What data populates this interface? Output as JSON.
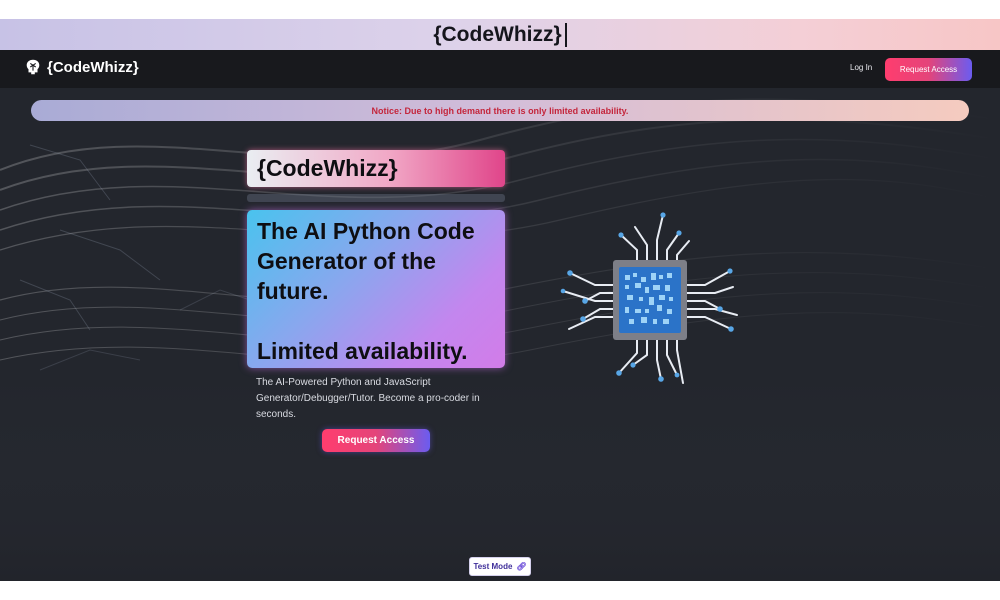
{
  "window": {
    "title": "{CodeWhizz}"
  },
  "navbar": {
    "brand_icon": "brain-icon",
    "brand_name": "{CodeWhizz}",
    "login_label": "Log In",
    "cta_label": "Request Access"
  },
  "notice": {
    "text": "Notice: Due to high demand there is only limited availability.",
    "color": "#c4263c"
  },
  "hero": {
    "brand": "{CodeWhizz}",
    "headline": "The AI Python Code Generator of the future.",
    "subheadline": "Limited availability.",
    "description": "The AI-Powered Python and JavaScript Generator/Debugger/Tutor. Become a pro-coder in seconds.",
    "cta_label": "Request Access",
    "illustration": "microchip-icon"
  },
  "footer": {
    "test_mode_label": "Test Mode",
    "test_mode_icon": "link-icon"
  },
  "colors": {
    "accent_pink": "#ff3d6e",
    "accent_purple": "#6b5cf0",
    "background": "#22242b",
    "navbar": "#18191d"
  }
}
